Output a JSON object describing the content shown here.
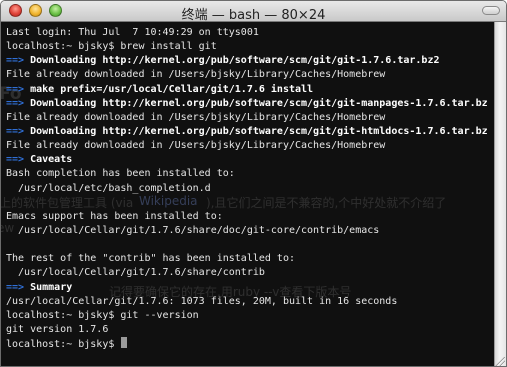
{
  "window": {
    "title": "终端 — bash — 80×24"
  },
  "terminal": {
    "lines": [
      {
        "segments": [
          {
            "t": "Last login: Thu Jul  7 10:49:29 on ttys001",
            "s": "plain"
          }
        ]
      },
      {
        "segments": [
          {
            "t": "localhost:~ bjsky$ brew install git",
            "s": "plain"
          }
        ]
      },
      {
        "segments": [
          {
            "t": "==> ",
            "s": "arrow"
          },
          {
            "t": "Downloading http://kernel.org/pub/software/scm/git/git-1.7.6.tar.bz2",
            "s": "bold"
          }
        ]
      },
      {
        "segments": [
          {
            "t": "File already downloaded in /Users/bjsky/Library/Caches/Homebrew",
            "s": "plain"
          }
        ]
      },
      {
        "segments": [
          {
            "t": "==> ",
            "s": "arrow"
          },
          {
            "t": "make prefix=/usr/local/Cellar/git/1.7.6 install",
            "s": "bold"
          }
        ]
      },
      {
        "segments": [
          {
            "t": "==> ",
            "s": "arrow"
          },
          {
            "t": "Downloading http://kernel.org/pub/software/scm/git/git-manpages-1.7.6.tar.bz",
            "s": "bold"
          }
        ]
      },
      {
        "segments": [
          {
            "t": "File already downloaded in /Users/bjsky/Library/Caches/Homebrew",
            "s": "plain"
          }
        ]
      },
      {
        "segments": [
          {
            "t": "==> ",
            "s": "arrow"
          },
          {
            "t": "Downloading http://kernel.org/pub/software/scm/git/git-htmldocs-1.7.6.tar.bz",
            "s": "bold"
          }
        ]
      },
      {
        "segments": [
          {
            "t": "File already downloaded in /Users/bjsky/Library/Caches/Homebrew",
            "s": "plain"
          }
        ]
      },
      {
        "segments": [
          {
            "t": "==> ",
            "s": "arrow"
          },
          {
            "t": "Caveats",
            "s": "bold"
          }
        ]
      },
      {
        "segments": [
          {
            "t": "Bash completion has been installed to:",
            "s": "plain"
          }
        ]
      },
      {
        "segments": [
          {
            "t": "  /usr/local/etc/bash_completion.d",
            "s": "plain"
          }
        ]
      },
      {
        "segments": [
          {
            "t": "",
            "s": "plain"
          }
        ]
      },
      {
        "segments": [
          {
            "t": "Emacs support has been installed to:",
            "s": "plain"
          }
        ]
      },
      {
        "segments": [
          {
            "t": "  /usr/local/Cellar/git/1.7.6/share/doc/git-core/contrib/emacs",
            "s": "plain"
          }
        ]
      },
      {
        "segments": [
          {
            "t": "",
            "s": "plain"
          }
        ]
      },
      {
        "segments": [
          {
            "t": "The rest of the \"contrib\" has been installed to:",
            "s": "plain"
          }
        ]
      },
      {
        "segments": [
          {
            "t": "  /usr/local/Cellar/git/1.7.6/share/contrib",
            "s": "plain"
          }
        ]
      },
      {
        "segments": [
          {
            "t": "==> ",
            "s": "arrow"
          },
          {
            "t": "Summary",
            "s": "bold"
          }
        ]
      },
      {
        "segments": [
          {
            "t": "/usr/local/Cellar/git/1.7.6: 1073 files, 20M, built in 16 seconds",
            "s": "plain"
          }
        ]
      },
      {
        "segments": [
          {
            "t": "localhost:~ bjsky$ git --version",
            "s": "plain"
          }
        ]
      },
      {
        "segments": [
          {
            "t": "git version 1.7.6",
            "s": "plain"
          }
        ]
      },
      {
        "segments": [
          {
            "t": "localhost:~ bjsky$ ",
            "s": "plain"
          }
        ],
        "cursor": true
      }
    ]
  },
  "background_page": {
    "fragments": [
      {
        "text": "Fo",
        "link": false
      },
      {
        "text": "上的软件包管理工具 (via ",
        "link": false
      },
      {
        "text": "Wikipedia",
        "link": true
      },
      {
        "text": "),且它们之间是不兼容的,个中好处就不介绍了",
        "link": false
      },
      {
        "text": "ew",
        "link": false
      },
      {
        "text": "记得要确保它的存在,用ruby --v查看下版本号",
        "link": false
      }
    ]
  },
  "colors": {
    "terminal_bg": "#101010",
    "text": "#e6e6e6",
    "arrow": "#2f6fd6"
  }
}
